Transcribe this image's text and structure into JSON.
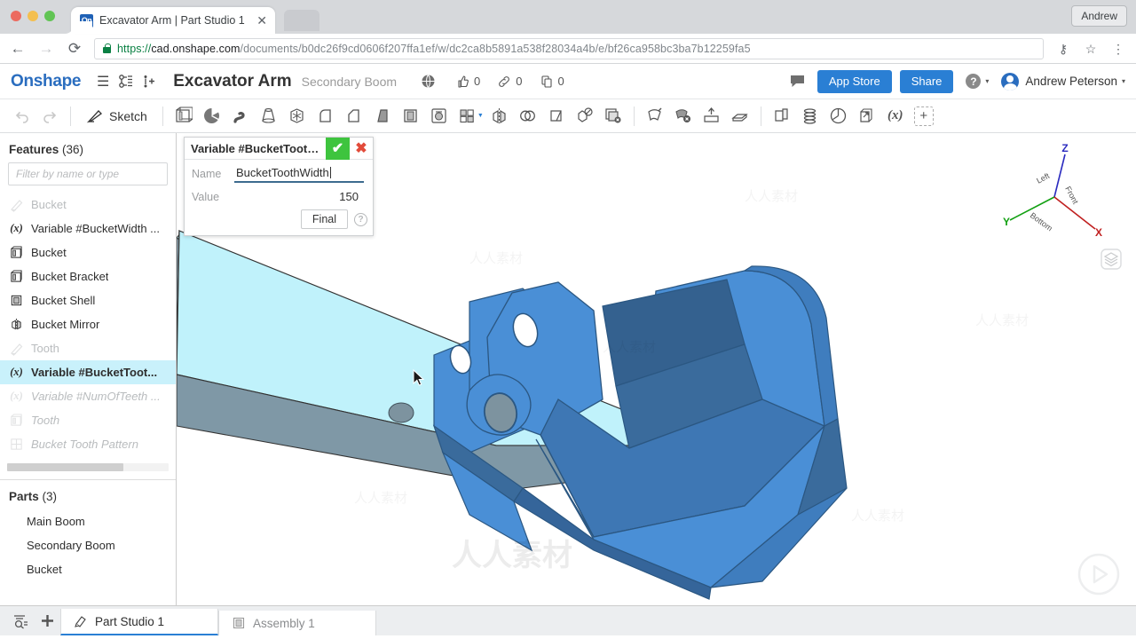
{
  "browser": {
    "tab": {
      "title": "Excavator Arm | Part Studio 1",
      "favicon_text": "On",
      "close_label": "✕"
    },
    "profile_button": "Andrew",
    "back_icon": "←",
    "forward_icon": "→",
    "reload_icon": "⟳",
    "url": {
      "scheme": "https://",
      "host": "cad.onshape.com",
      "path": "/documents/b0dc26f9cd0606f207ffa1ef/w/dc2ca8b5891a538f28034a4b/e/bf26ca958bc3ba7b12259fa5"
    },
    "key_icon": "⚷",
    "star_icon": "☆",
    "menu_icon": "⋮"
  },
  "header": {
    "logo": "Onshape",
    "menu_icon": "☰",
    "versions_icon": "version-graph-icon",
    "insert_icon": "branch-icon",
    "doc_title": "Excavator Arm",
    "doc_subtitle": "Secondary Boom",
    "globe_icon": "globe-icon",
    "counts": [
      {
        "icon": "thumbs-up-icon",
        "value": "0"
      },
      {
        "icon": "link-icon",
        "value": "0"
      },
      {
        "icon": "copy-icon",
        "value": "0"
      }
    ],
    "comment_icon": "comment-icon",
    "app_store": "App Store",
    "share": "Share",
    "help": "?",
    "user_name": "Andrew Peterson",
    "caret": "▾",
    "accent_blue": "#2a7fd4"
  },
  "toolbar": {
    "undo_icon": "undo-arrow-icon",
    "redo_icon": "redo-arrow-icon",
    "sketch_label": "Sketch",
    "tools": [
      "extrude-icon",
      "revolve-icon",
      "sweep-icon",
      "loft-icon",
      "enclose-icon",
      "fillet-icon",
      "chamfer-icon",
      "draft-icon",
      "shell-icon",
      "hole-icon",
      "pattern-icon",
      "mirror-icon",
      "boolean-icon",
      "split-icon",
      "transform-icon",
      "delete-face-icon",
      "move-face-icon",
      "replace-face-icon",
      "thicken-icon",
      "delete-part-icon",
      "plane-icon",
      "helix-icon",
      "sketch-plane-icon",
      "use-icon",
      "curve-icon"
    ],
    "variable_icon": "(x)",
    "add_custom_feature": "+"
  },
  "features_panel": {
    "heading_label": "Features",
    "heading_count": "(36)",
    "filter_placeholder": "Filter by name or type",
    "items": [
      {
        "icon": "sketch-pencil-icon",
        "label": "Bucket",
        "state": "suppressed"
      },
      {
        "icon": "variable-icon",
        "label": "Variable #BucketWidth ...",
        "state": "normal"
      },
      {
        "icon": "extrude-icon",
        "label": "Bucket",
        "state": "normal"
      },
      {
        "icon": "extrude-icon",
        "label": "Bucket Bracket",
        "state": "normal"
      },
      {
        "icon": "shell-icon",
        "label": "Bucket Shell",
        "state": "normal"
      },
      {
        "icon": "mirror-icon",
        "label": "Bucket Mirror",
        "state": "normal"
      },
      {
        "icon": "sketch-pencil-icon",
        "label": "Tooth",
        "state": "suppressed"
      },
      {
        "icon": "variable-icon",
        "label": "Variable #BucketToot...",
        "state": "selected"
      },
      {
        "icon": "variable-icon",
        "label": "Variable #NumOfTeeth ...",
        "state": "rolled-back"
      },
      {
        "icon": "extrude-icon",
        "label": "Tooth",
        "state": "rolled-back"
      },
      {
        "icon": "pattern-icon",
        "label": "Bucket Tooth Pattern",
        "state": "rolled-back"
      }
    ]
  },
  "parts_panel": {
    "heading_label": "Parts",
    "heading_count": "(3)",
    "items": [
      "Main Boom",
      "Secondary Boom",
      "Bucket"
    ]
  },
  "variable_dialog": {
    "title": "Variable #BucketToothW...",
    "confirm_icon": "✔",
    "cancel_icon": "✖",
    "name_label": "Name",
    "name_value": "BucketToothWidth",
    "value_label": "Value",
    "value_value": "150",
    "final_button": "Final",
    "help_icon": "?",
    "confirm_color": "#3ec43e",
    "cancel_color": "#e24b3a"
  },
  "viewport": {
    "triad": {
      "z_label": "Z",
      "y_label": "Y",
      "x_label": "X",
      "left_label": "Left",
      "front_label": "Front",
      "bottom_label": "Bottom",
      "z_color": "#2b2bbf",
      "y_color": "#12a012",
      "x_color": "#c02020"
    },
    "layers_icon": "cube-layers-icon",
    "play_icon": "▷",
    "model_colors": {
      "bucket_blue": "#4a8fd6",
      "bucket_dark": "#3a6fa8",
      "bucket_darker": "#2f5d91",
      "selected_cyan": "#b8f0fa",
      "arm_gray": "#7b94a3"
    },
    "watermarks": [
      "人人素材",
      "人人素材"
    ]
  },
  "bottom_bar": {
    "search_icon": "filter-search-icon",
    "add_icon": "+",
    "tabs": [
      {
        "icon": "part-studio-icon",
        "label": "Part Studio 1",
        "active": true
      },
      {
        "icon": "assembly-icon",
        "label": "Assembly 1",
        "active": false
      }
    ]
  }
}
